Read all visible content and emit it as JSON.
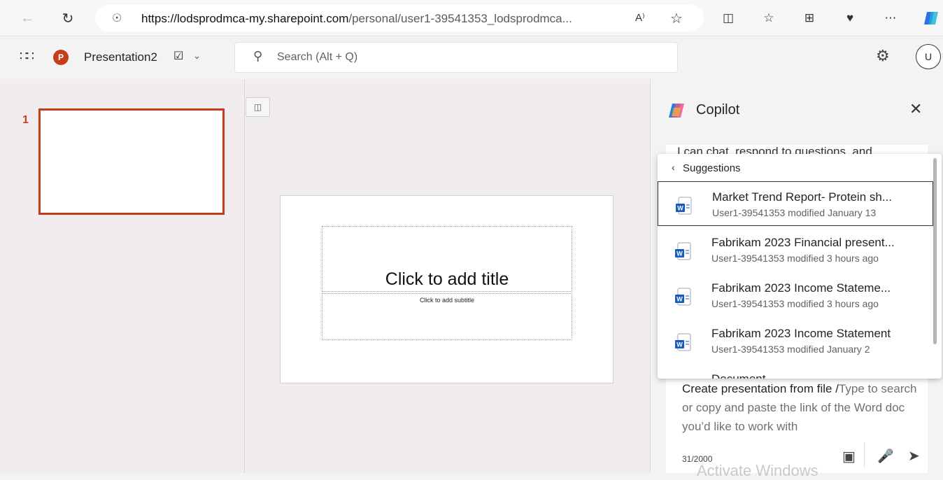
{
  "browser": {
    "url_host": "https://lodsprodmca-my.sharepoint.com",
    "url_path": "/personal/user1-39541353_lodsprodmca..."
  },
  "app": {
    "name": "Presentation2",
    "search_placeholder": "Search (Alt + Q)",
    "avatar_initial": "U",
    "brand_color": "#c43e1c"
  },
  "thumbnails": {
    "slide_number": "1"
  },
  "slide": {
    "title_placeholder": "Click to add title",
    "subtitle_placeholder": "Click to add subtitle"
  },
  "copilot": {
    "title": "Copilot",
    "chat_preview": "I can chat, respond to questions, and",
    "suggestions_heading": "Suggestions",
    "suggestions": [
      {
        "title": "Market Trend Report- Protein sh...",
        "subtitle": "User1-39541353 modified January 13"
      },
      {
        "title": "Fabrikam 2023 Financial present...",
        "subtitle": "User1-39541353 modified 3 hours ago"
      },
      {
        "title": "Fabrikam 2023 Income Stateme...",
        "subtitle": "User1-39541353 modified 3 hours ago"
      },
      {
        "title": "Fabrikam 2023 Income Statement",
        "subtitle": "User1-39541353 modified January 2"
      },
      {
        "title": "Document",
        "subtitle": ""
      }
    ],
    "input_prefix": "Create presentation from file /",
    "input_placeholder": "Type to search or copy and paste the link of the Word doc you’d like to work with",
    "char_count": "31/2000"
  },
  "watermark": "Activate Windows"
}
